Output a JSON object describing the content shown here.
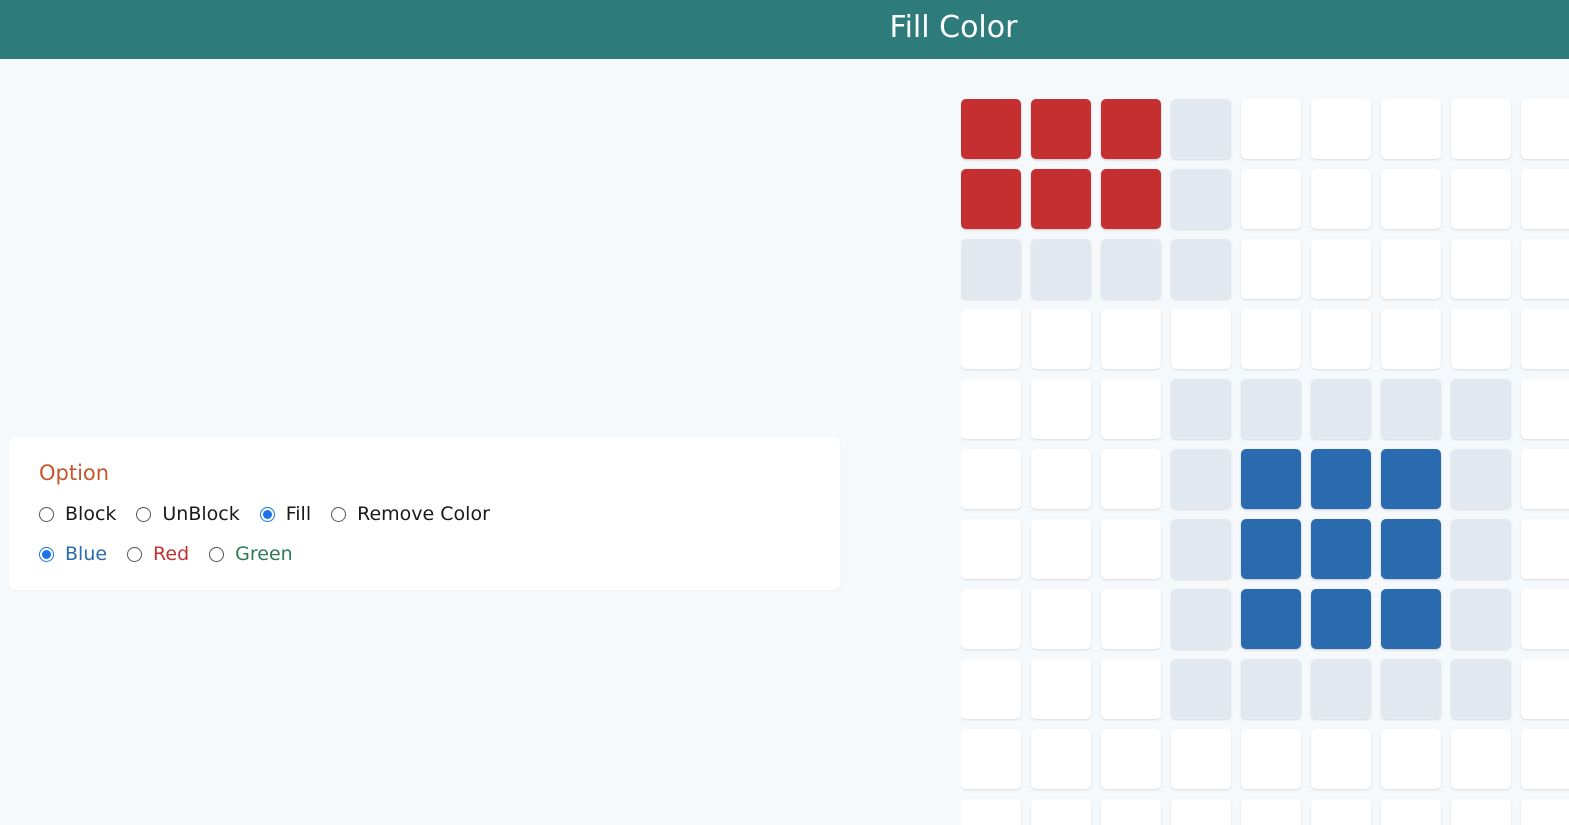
{
  "header": {
    "title": "Fill Color"
  },
  "options": {
    "title": "Option",
    "modes": [
      {
        "label": "Block",
        "checked": false
      },
      {
        "label": "UnBlock",
        "checked": false
      },
      {
        "label": "Fill",
        "checked": true
      },
      {
        "label": "Remove Color",
        "checked": false
      }
    ],
    "colors": [
      {
        "label": "Blue",
        "checked": true,
        "color": "#2a6ab0"
      },
      {
        "label": "Red",
        "checked": false,
        "color": "#c33232"
      },
      {
        "label": "Green",
        "checked": false,
        "color": "#2f7a57"
      }
    ]
  },
  "palette": {
    "header_bg": "#2e7b7c",
    "page_bg": "#f5f9fb",
    "cell_empty": "#ffffff",
    "cell_blocked": "#e2e8ef",
    "cell_red": "#c62f30",
    "cell_blue": "#2a6bb0",
    "option_title": "#c4582c"
  },
  "grid": {
    "legend": {
      "0": "empty",
      "1": "blocked",
      "R": "red",
      "B": "blue"
    },
    "rows": [
      "RRR100000",
      "RRR100000",
      "111100000",
      "000000000",
      "000111110",
      "0001BBB10",
      "0001BBB10",
      "0001BBB10",
      "000111110",
      "000000000",
      "000000000"
    ]
  }
}
